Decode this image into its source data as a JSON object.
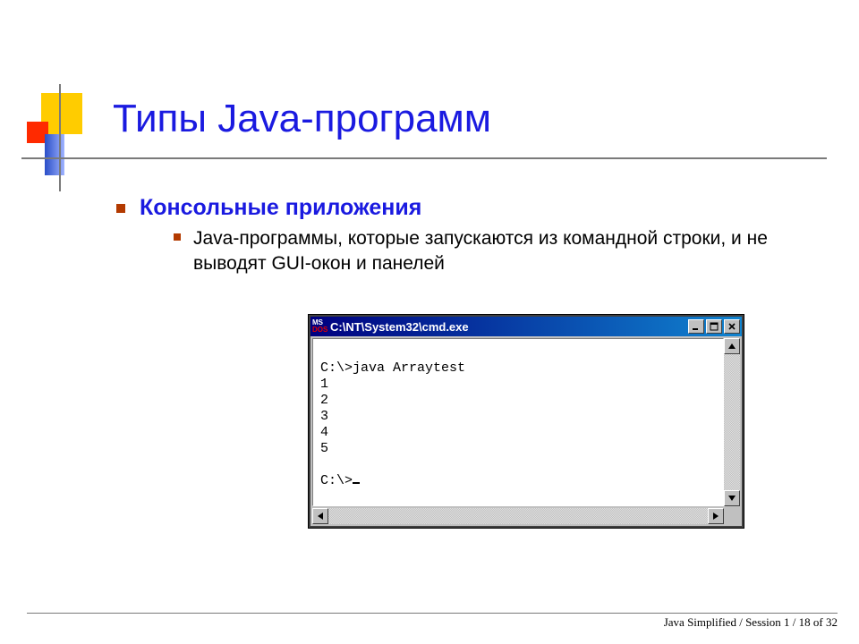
{
  "title": "Типы Java-программ",
  "bullet1": "Консольные приложения",
  "bullet2": "Java-программы, которые запускаются из командной строки, и не выводят GUI-окон и панелей",
  "cmd": {
    "icon_top": "MS",
    "icon_bottom": "DOS",
    "title": "C:\\NT\\System32\\cmd.exe",
    "lines": [
      "",
      "C:\\>java Arraytest",
      "1",
      "2",
      "3",
      "4",
      "5",
      "",
      "C:\\>"
    ]
  },
  "footer": "Java Simplified /  Session 1 / 18 of 32"
}
